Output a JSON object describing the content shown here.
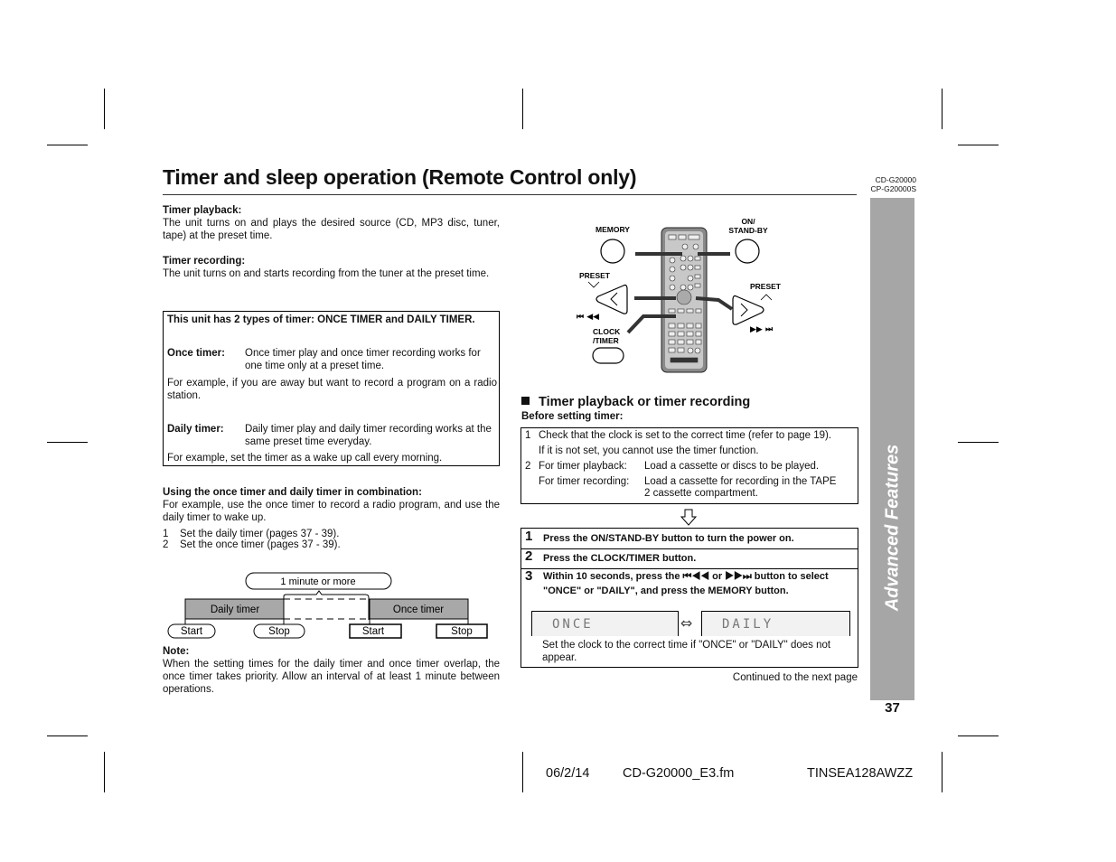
{
  "page": {
    "title": "Timer and sleep operation (Remote Control only)",
    "model_numbers": [
      "CD-G20000",
      "CP-G20000S"
    ],
    "side_tab": "Advanced Features",
    "page_number": "37"
  },
  "left": {
    "timer_playback": {
      "heading": "Timer playback:",
      "text": "The unit turns on and plays the desired source (CD, MP3 disc, tuner, tape) at the preset time."
    },
    "timer_recording": {
      "heading": "Timer recording:",
      "text": "The unit turns on and starts recording from the tuner at the preset time."
    },
    "types_box": {
      "heading": "This unit has 2 types of timer: ONCE TIMER and DAILY TIMER.",
      "once_label": "Once timer:",
      "once_text": "Once timer play and once timer recording works for one time only at a preset time.",
      "once_example": "For example, if you are away but want to record a program on a radio station.",
      "daily_label": "Daily timer:",
      "daily_text": "Daily timer play and daily timer recording works at the same preset time everyday.",
      "daily_example": "For example, set the timer as a wake up call every morning."
    },
    "combination": {
      "heading": "Using the once timer and daily timer in combination:",
      "text": "For example, use the once timer to record a radio program, and use the daily timer to wake up.",
      "steps": [
        {
          "n": "1",
          "text": "Set the daily timer (pages 37 - 39)."
        },
        {
          "n": "2",
          "text": "Set the once timer (pages 37 - 39)."
        }
      ]
    },
    "diagram": {
      "interval_label": "1 minute or more",
      "daily_bar": "Daily timer",
      "once_bar": "Once timer",
      "daily_start": "Start",
      "daily_stop": "Stop",
      "once_start": "Start",
      "once_stop": "Stop"
    },
    "note": {
      "heading": "Note:",
      "text": "When the setting times for the daily timer and once timer overlap, the once timer takes priority. Allow an interval of at least 1 minute between operations."
    }
  },
  "remote": {
    "memory": "MEMORY",
    "on_standby_1": "ON/",
    "on_standby_2": "STAND-BY",
    "preset_left": "PRESET",
    "preset_right": "PRESET",
    "prev_symbols": "⏮ ◀◀",
    "next_symbols": "▶▶ ⏭",
    "clock_1": "CLOCK",
    "clock_2": "/TIMER"
  },
  "right": {
    "section_heading": "Timer playback or timer recording",
    "before_heading": "Before setting timer:",
    "before": {
      "item1_n": "1",
      "item1_a": "Check that the clock is set to the correct time (refer to page 19).",
      "item1_b": "If it is not set, you cannot use the timer function.",
      "item2_n": "2",
      "item2_label_a": "For timer playback:",
      "item2_text_a": "Load a cassette or discs to be played.",
      "item2_label_b": "For timer recording:",
      "item2_text_b1": "Load a cassette for recording in the TAPE",
      "item2_text_b2": "2 cassette compartment."
    },
    "steps": [
      {
        "n": "1",
        "text": "Press the ON/STAND-BY button to turn the power on."
      },
      {
        "n": "2",
        "text": "Press the CLOCK/TIMER button."
      },
      {
        "n": "3",
        "text": "Within 10 seconds, press the ⏮◀◀ or ▶▶⏭ button to select \"ONCE\" or \"DAILY\", and press the MEMORY button."
      }
    ],
    "lcd_once": "ONCE",
    "lcd_daily": "DAILY",
    "lcd_arrow": "⇔",
    "lcd_note": "Set the clock to the correct time if \"ONCE\" or \"DAILY\" does not appear.",
    "continued": "Continued to the next page"
  },
  "footer": {
    "date": "06/2/14",
    "file": "CD-G20000_E3.fm",
    "code": "TINSEA128AWZZ"
  }
}
